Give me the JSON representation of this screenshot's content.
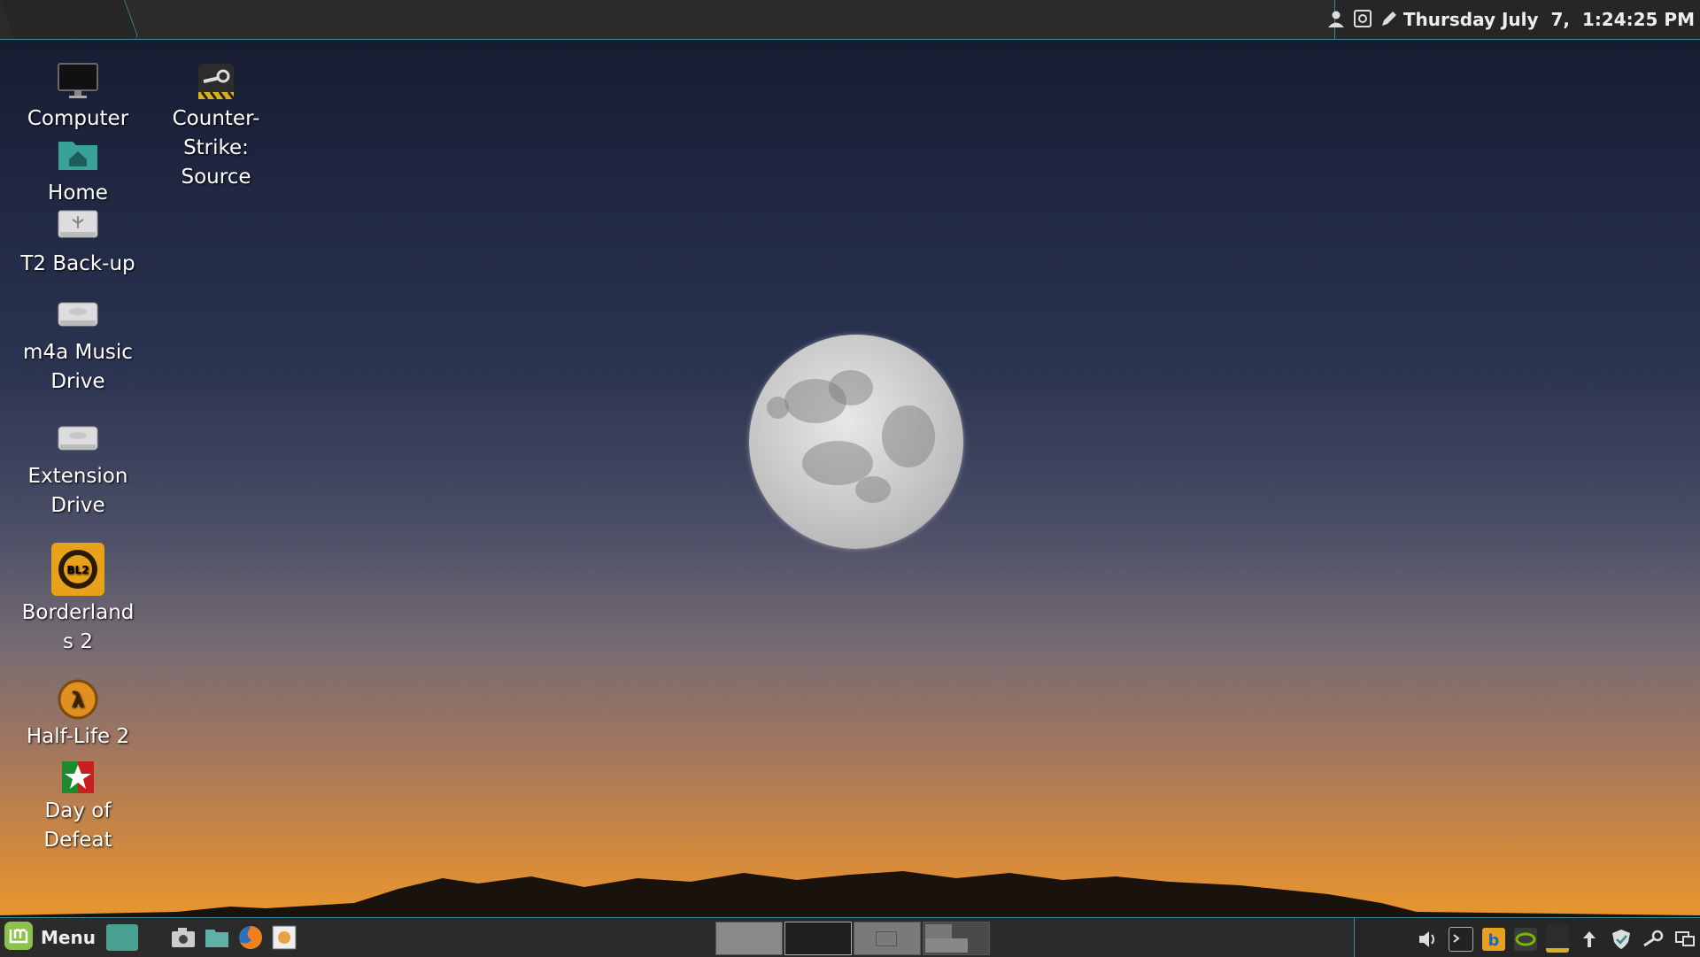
{
  "top_panel": {
    "clock": "Thursday July  7,  1:24:25 PM",
    "icons": [
      "user-icon",
      "screenshot-icon",
      "pen-icon"
    ]
  },
  "desktop_icons": [
    {
      "label": "Computer",
      "icon": "computer-icon"
    },
    {
      "label": "Home",
      "icon": "home-folder-icon"
    },
    {
      "label": "T2 Back-up",
      "icon": "usb-drive-icon"
    },
    {
      "label": "m4a Music Drive",
      "icon": "hard-drive-icon"
    },
    {
      "label": "Extension Drive",
      "icon": "hard-drive-icon"
    },
    {
      "label": "Borderlands 2",
      "icon": "borderlands-2-icon"
    },
    {
      "label": "Half-Life 2",
      "icon": "half-life-2-icon"
    },
    {
      "label": "Day of Defeat",
      "icon": "day-of-defeat-icon"
    },
    {
      "label": "Counter-Strike: Source",
      "icon": "steam-icon"
    }
  ],
  "bottom_panel": {
    "menu_label": "Menu",
    "launchers": [
      "show-desktop-icon",
      "screenshot-camera-icon",
      "files-icon",
      "firefox-icon",
      "image-viewer-icon"
    ],
    "workspace_count": 4,
    "tray": [
      "volume-icon",
      "terminal-icon",
      "bluetooth-app-icon",
      "nvidia-icon",
      "steam-tray-icon",
      "update-arrow-icon",
      "shield-icon",
      "steam-icon",
      "display-icon"
    ]
  },
  "colors": {
    "panel": "#2b2b2b",
    "accent": "#3a8a95"
  }
}
